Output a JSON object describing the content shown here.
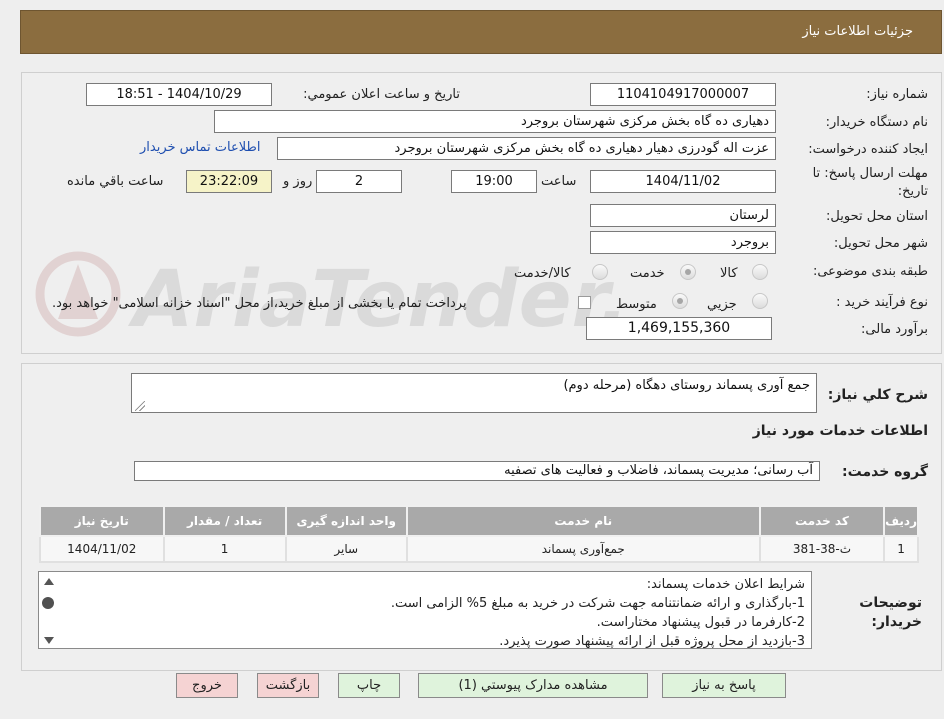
{
  "header": {
    "title": "جزئیات اطلاعات نیاز"
  },
  "labels": {
    "need_number": "شماره نیاز:",
    "announce_datetime": "تاریخ و ساعت اعلان عمومي:",
    "buyer_org": "نام دستگاه خريدار:",
    "requester": "ايجاد كننده درخواست:",
    "deadline": "مهلت ارسال پاسخ: تا تاریخ:",
    "time_word": "ساعت",
    "days_word": "روز و",
    "remaining": "ساعت باقي مانده",
    "province": "استان محل تحويل:",
    "city": "شهر محل تحويل:",
    "category": "طبقه بندی موضوعی:",
    "process": "نوع فرآيند خريد :",
    "budget": "برآورد مالی:",
    "summary": "شرح كلي نياز:",
    "services_info": "اطلاعات خدمات مورد نياز",
    "service_group": "گروه خدمت:",
    "buyer_notes": "توضيحات خريدار:"
  },
  "form": {
    "need_number": "1104104917000007",
    "announce_datetime": "1404/10/29 - 18:51",
    "buyer_org": "دهياری ده گاه بخش مرکزی شهرستان بروجرد",
    "requester": "عزت اله گودرزی دهيار دهياری ده گاه بخش مرکزی شهرستان بروجرد",
    "contact_link": "اطلاعات تماس خریدار",
    "deadline_date": "1404/11/02",
    "deadline_time": "19:00",
    "days": "2",
    "remaining_time": "23:22:09",
    "province": "لرستان",
    "city": "بروجرد",
    "category_options": [
      "کالا",
      "خدمت",
      "کالا/خدمت"
    ],
    "category_selected": "خدمت",
    "process_options": [
      "جزيي",
      "متوسط"
    ],
    "process_selected": "متوسط",
    "payment_note": "پرداخت تمام یا بخشی از مبلغ خرید،از محل \"اسناد خزانه اسلامی\" خواهد بود.",
    "budget": "1,469,155,360",
    "summary": "جمع آوری پسماند روستای دهگاه (مرحله دوم)",
    "service_group": "آب رسانی؛ مدیریت پسماند، فاضلاب و فعالیت های تصفیه"
  },
  "table": {
    "headers": [
      "ردیف",
      "کد خدمت",
      "نام خدمت",
      "واحد اندازه گیری",
      "تعداد / مقدار",
      "تاریخ نیاز"
    ],
    "rows": [
      [
        "1",
        "ث-38-381",
        "جمع‌آوری پسماند",
        "سایر",
        "1",
        "1404/11/02"
      ]
    ]
  },
  "notes": [
    "شرايط اعلان خدمات پسماند:",
    "1-بارگذاری و ارائه ضمانتنامه جهت شرکت در خريد به مبلغ 5% الزامی است.",
    "2-کارفرما در قبول پيشنهاد مختاراست.",
    "3-بازديد از محل پروژه قبل از ارائه پيشنهاد صورت پذيرد."
  ],
  "buttons": {
    "reply": "پاسخ به نياز",
    "attachments": "مشاهده مدارک پيوستي (1)",
    "print": "چاپ",
    "back": "بازگشت",
    "exit": "خروج"
  },
  "watermark": "AriaTender.net",
  "colors": {
    "header": "#8b6d3f",
    "green_button": "#dff3dc",
    "pink_button": "#f5d3d3",
    "remaining_bg": "#f6f3c8",
    "table_header": "#a9a9a9"
  }
}
